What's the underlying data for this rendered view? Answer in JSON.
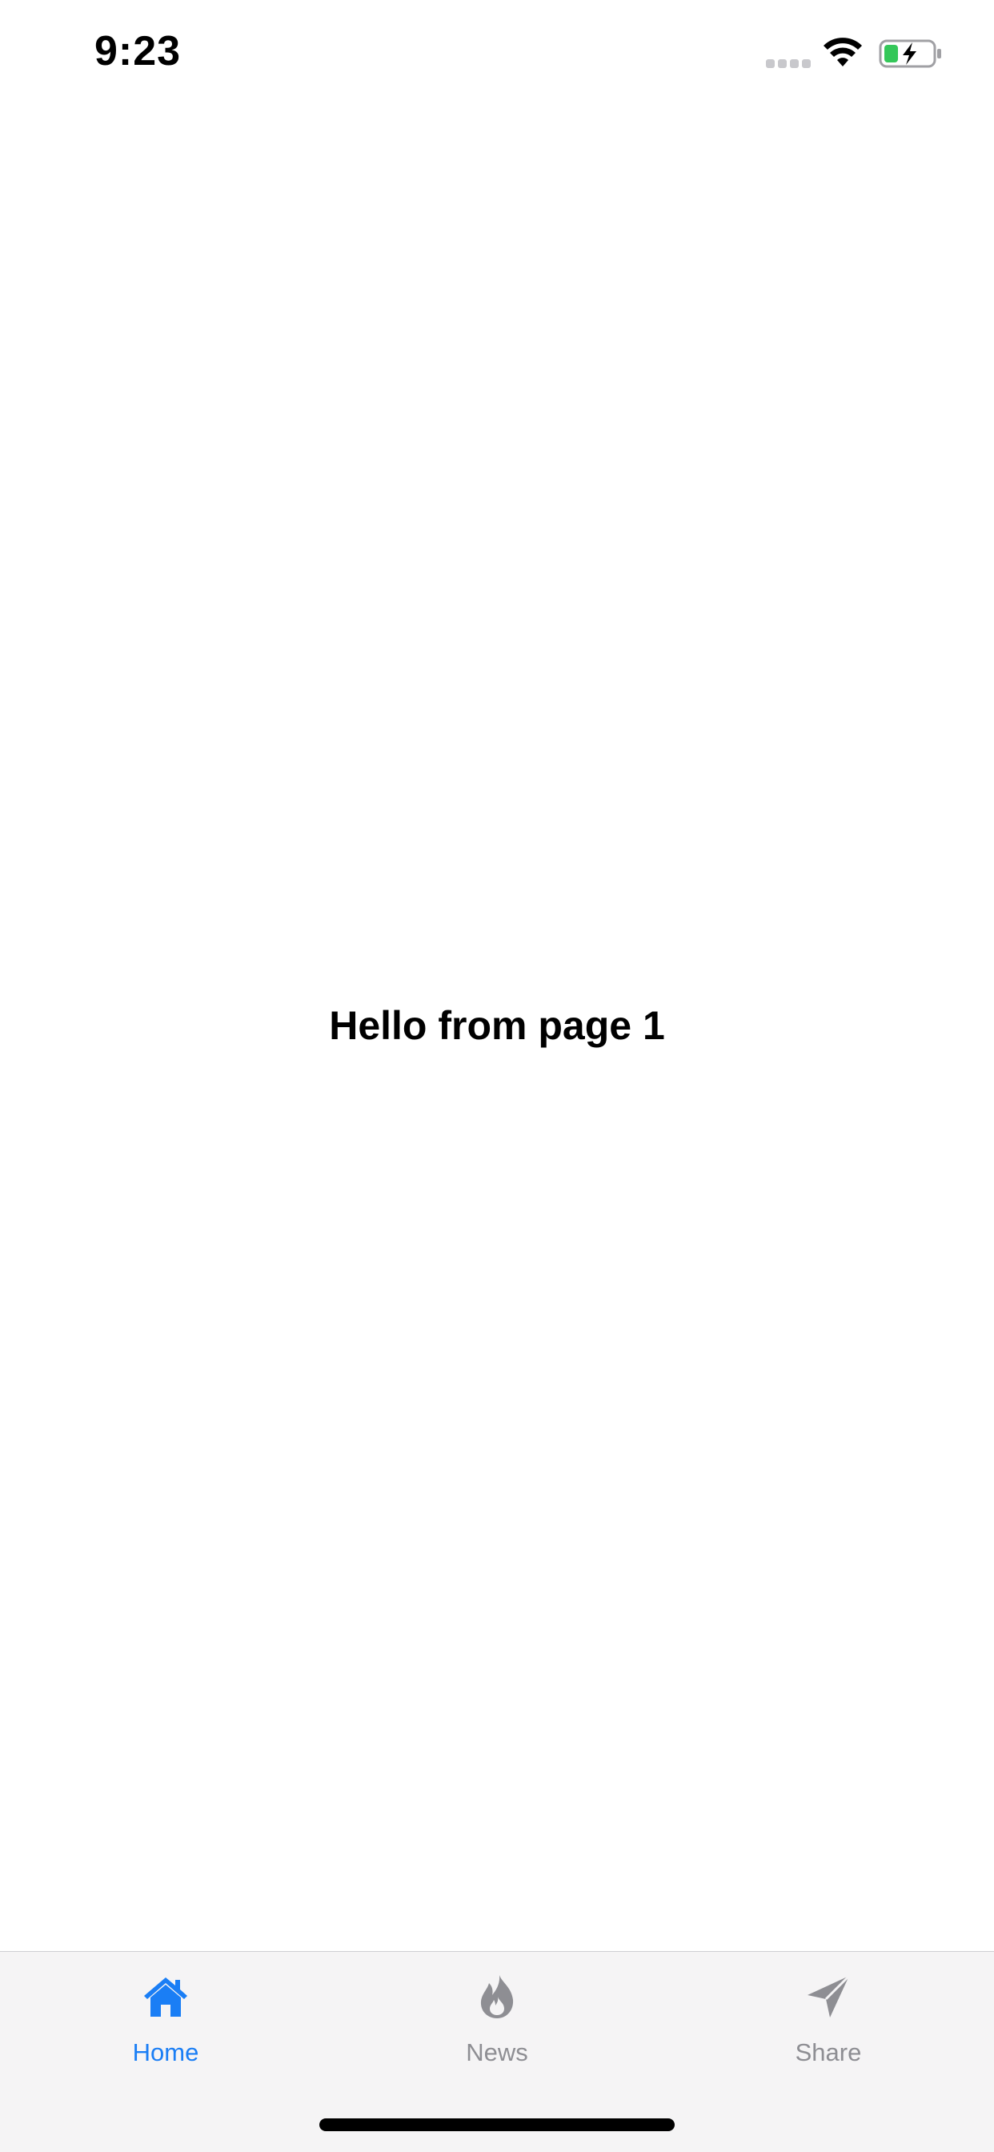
{
  "status_bar": {
    "time": "9:23",
    "icons": [
      "cellular-signal-icon",
      "wifi-icon",
      "battery-charging-icon"
    ]
  },
  "main": {
    "text": "Hello from page 1"
  },
  "tab_bar": {
    "active_color": "#1a7ef5",
    "inactive_color": "#8e8e93",
    "tabs": [
      {
        "label": "Home",
        "icon": "home-icon",
        "active": true
      },
      {
        "label": "News",
        "icon": "flame-icon",
        "active": false
      },
      {
        "label": "Share",
        "icon": "paper-plane-icon",
        "active": false
      }
    ]
  }
}
